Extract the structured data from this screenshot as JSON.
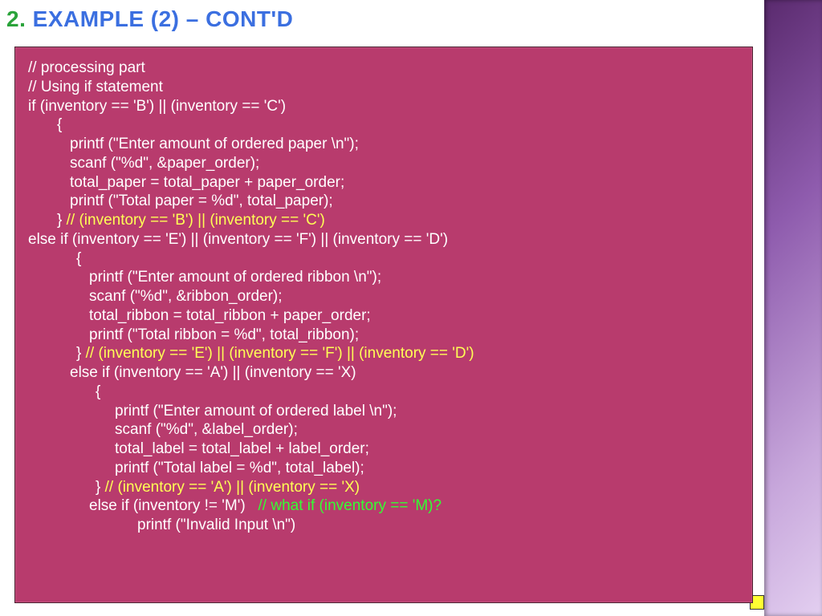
{
  "heading": {
    "number": "2.",
    "title": "EXAMPLE (2) – CONT'D"
  },
  "code": {
    "l01": "// processing part",
    "l02": "// Using if statement",
    "l03": "if (inventory == 'B') || (inventory == 'C')",
    "l04": "{",
    "l05": "printf (\"Enter amount of ordered paper \\n\");",
    "l06": "scanf (\"%d\", &paper_order);",
    "l07": "total_paper = total_paper + paper_order;",
    "l08": "printf (\"Total paper = %d\", total_paper);",
    "l09a": "} ",
    "l09b": "// (inventory == 'B') || (inventory == 'C')",
    "l10": "else if (inventory == 'E') || (inventory == 'F') || (inventory == 'D')",
    "l11": "{",
    "l12": "printf (\"Enter amount of ordered ribbon \\n\");",
    "l13": "scanf (\"%d\", &ribbon_order);",
    "l14": "total_ribbon = total_ribbon + paper_order;",
    "l15": "printf (\"Total ribbon = %d\", total_ribbon);",
    "l16a": "} ",
    "l16b": "// (inventory == 'E') || (inventory == 'F') || (inventory == 'D')",
    "l17": "else if (inventory == 'A') || (inventory == 'X)",
    "l18": "{",
    "l19": "printf (\"Enter amount of ordered label \\n\");",
    "l20": "scanf (\"%d\", &label_order);",
    "l21": "total_label = total_label + label_order;",
    "l22": "printf (\"Total label = %d\", total_label);",
    "l23a": "} ",
    "l23b": "// (inventory == 'A') || (inventory == 'X)",
    "l24a": "else if (inventory != 'M')   ",
    "l24b": "// what if (inventory == 'M)?",
    "l25": "printf (\"Invalid Input \\n\")"
  }
}
